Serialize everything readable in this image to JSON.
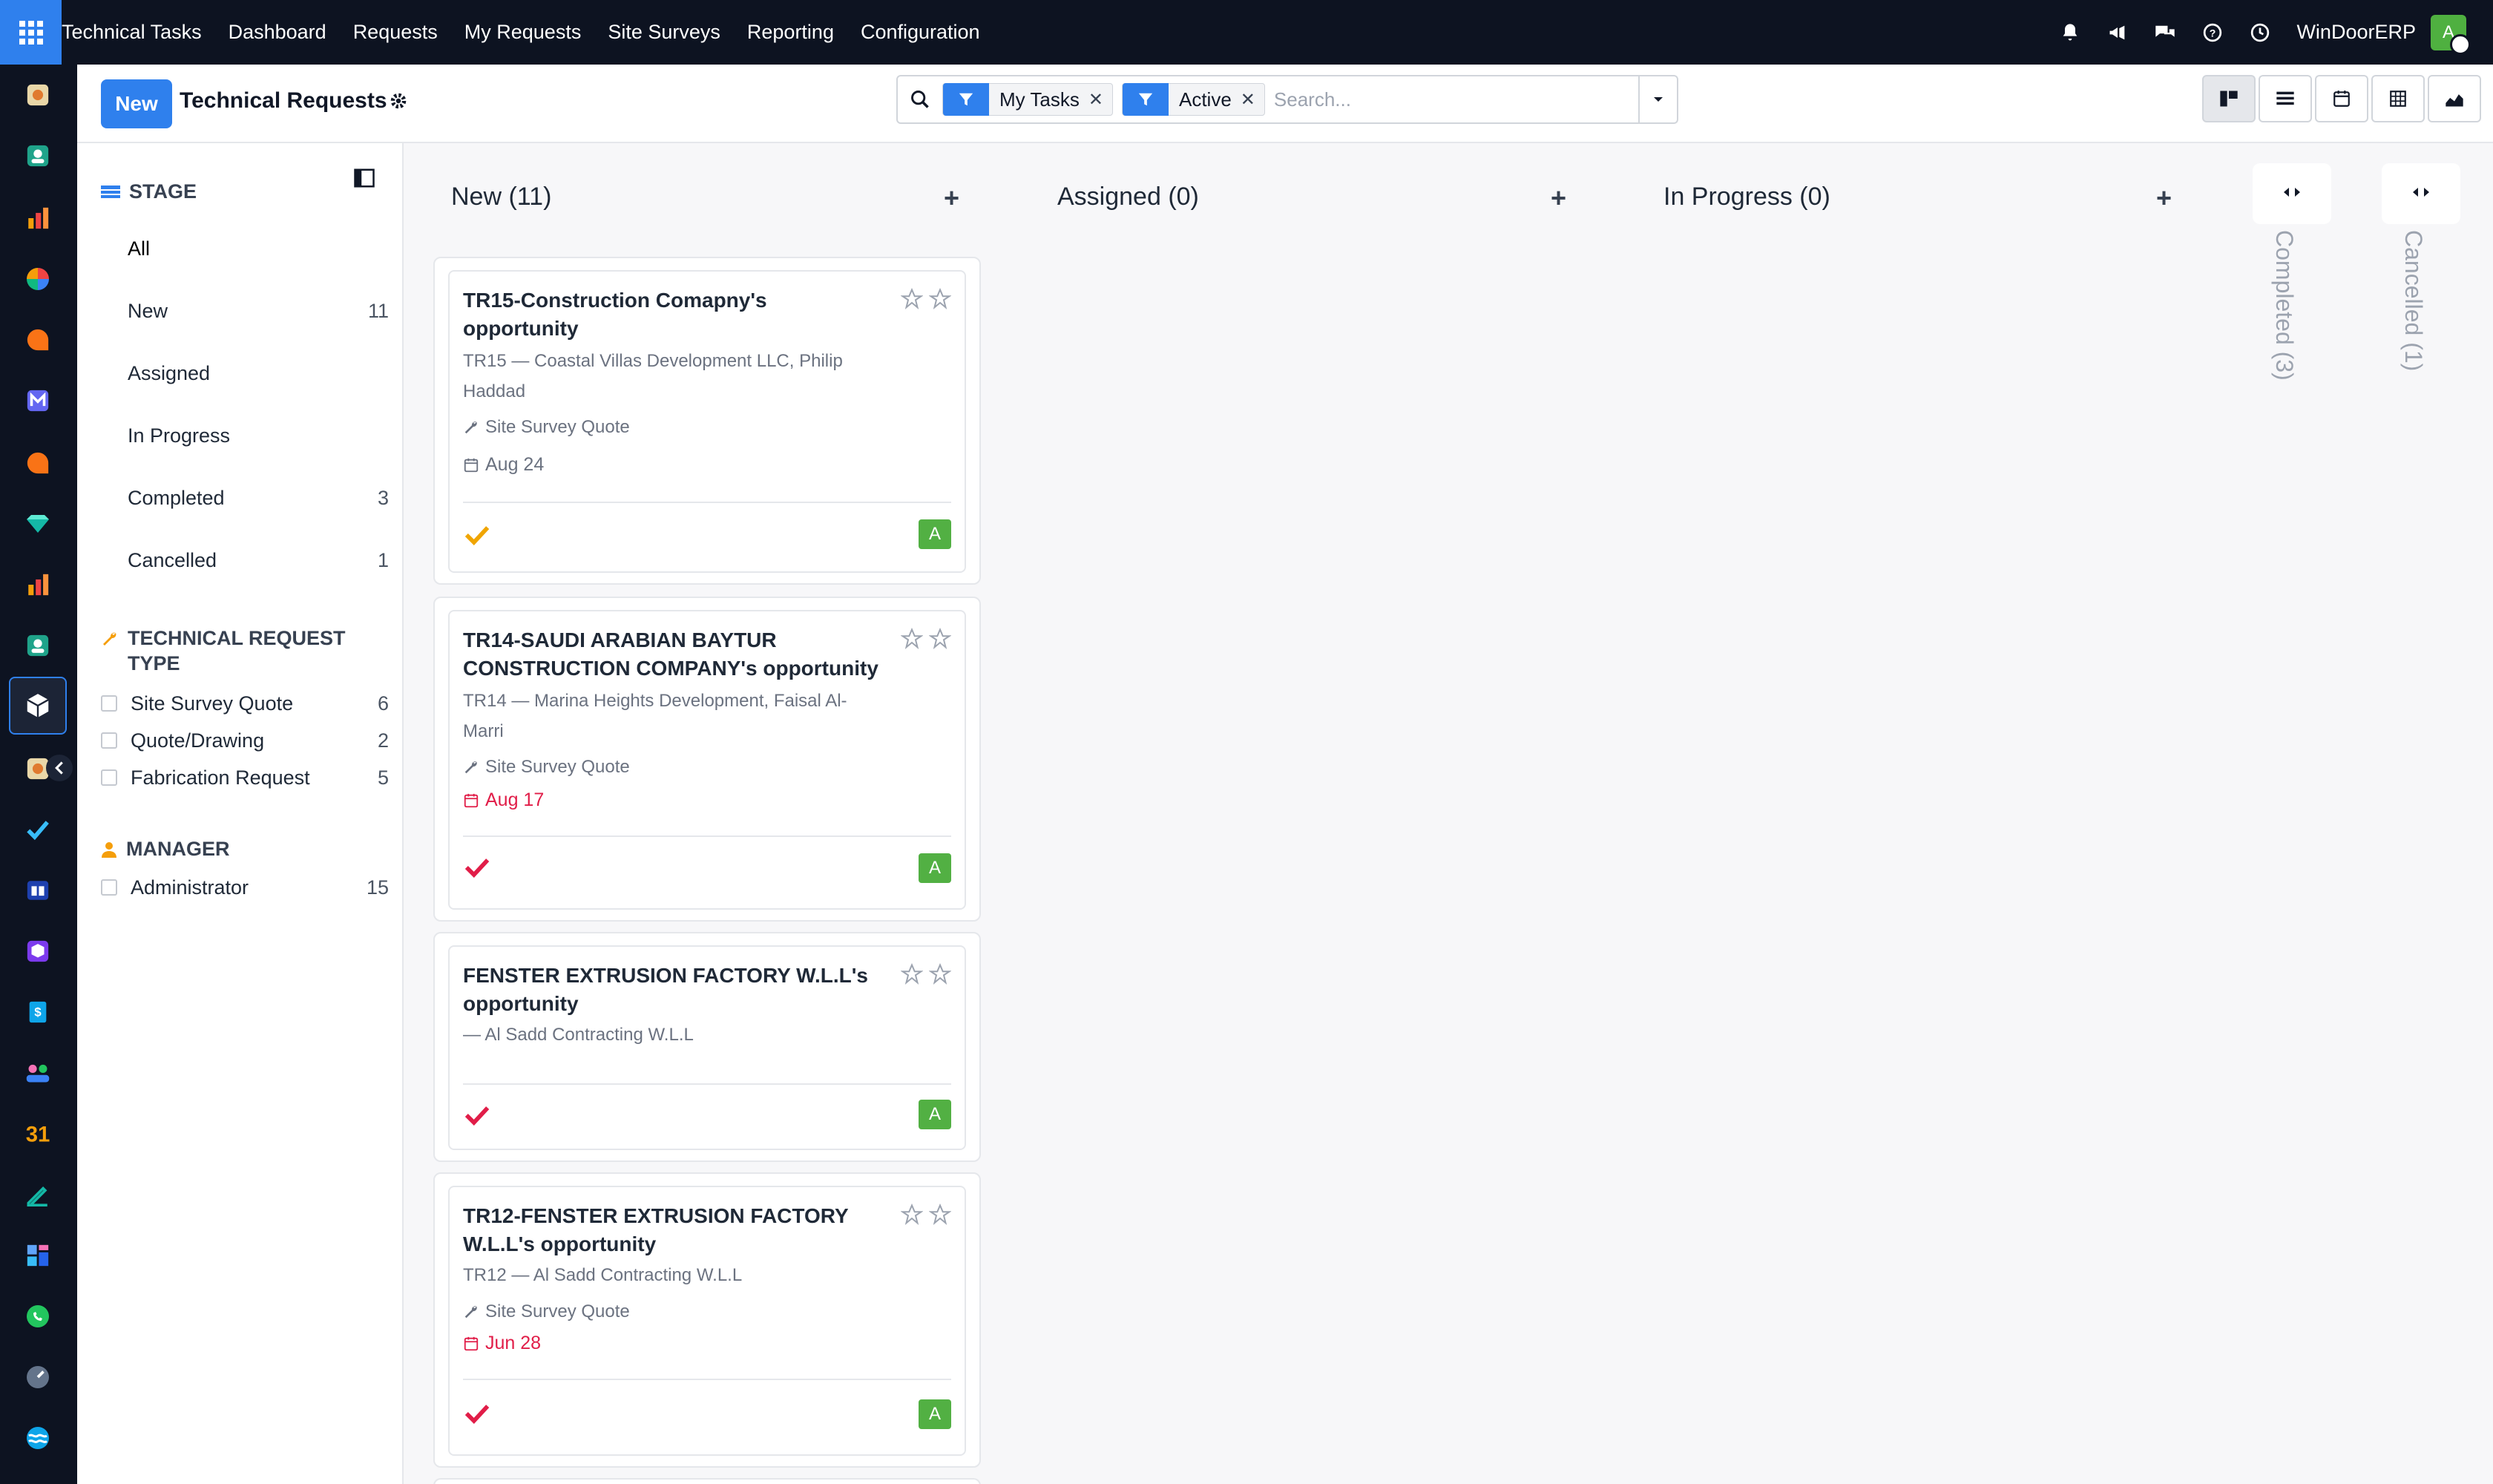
{
  "nav": {
    "app_name": "Technical Tasks",
    "menu": [
      "Dashboard",
      "Requests",
      "My Requests",
      "Site Surveys",
      "Reporting",
      "Configuration"
    ],
    "company": "WinDoorERP",
    "user_initial": "A"
  },
  "control": {
    "new_label": "New",
    "title": "Technical Requests",
    "facets": [
      "My Tasks",
      "Active"
    ],
    "search_placeholder": "Search..."
  },
  "sidebar": {
    "stage_header": "STAGE",
    "stages": [
      {
        "label": "All",
        "count": ""
      },
      {
        "label": "New",
        "count": "11"
      },
      {
        "label": "Assigned",
        "count": ""
      },
      {
        "label": "In Progress",
        "count": ""
      },
      {
        "label": "Completed",
        "count": "3"
      },
      {
        "label": "Cancelled",
        "count": "1"
      }
    ],
    "type_header": "TECHNICAL REQUEST TYPE",
    "types": [
      {
        "label": "Site Survey Quote",
        "count": "6"
      },
      {
        "label": "Quote/Drawing",
        "count": "2"
      },
      {
        "label": "Fabrication Request",
        "count": "5"
      }
    ],
    "manager_header": "MANAGER",
    "managers": [
      {
        "label": "Administrator",
        "count": "15"
      }
    ]
  },
  "columns": [
    {
      "title": "New (11)"
    },
    {
      "title": "Assigned (0)"
    },
    {
      "title": "In Progress (0)"
    }
  ],
  "folded_columns": [
    {
      "title": "Completed (3)"
    },
    {
      "title": "Cancelled (1)"
    }
  ],
  "cards": [
    {
      "title": "TR15-Construction Comapny's opportunity",
      "subtitle": "TR15 — Coastal Villas Development LLC, Philip Haddad",
      "type": "Site Survey Quote",
      "date": "Aug 24",
      "overdue": false,
      "check_color": "#f0a500",
      "assignee": "A"
    },
    {
      "title": "TR14-SAUDI ARABIAN BAYTUR CONSTRUCTION COMPANY's opportunity",
      "subtitle": "TR14 — Marina Heights Development, Faisal Al-Marri",
      "type": "Site Survey Quote",
      "date": "Aug 17",
      "overdue": true,
      "check_color": "#e11d48",
      "assignee": "A"
    },
    {
      "title": "FENSTER EXTRUSION FACTORY W.L.L's opportunity",
      "subtitle": "— Al Sadd Contracting W.L.L",
      "type": "",
      "date": "",
      "overdue": false,
      "check_color": "#e11d48",
      "assignee": "A"
    },
    {
      "title": "TR12-FENSTER EXTRUSION FACTORY W.L.L's opportunity",
      "subtitle": "TR12 — Al Sadd Contracting W.L.L",
      "type": "Site Survey Quote",
      "date": "Jun 28",
      "overdue": true,
      "check_color": "#e11d48",
      "assignee": "A"
    }
  ],
  "colors": {
    "primary": "#2f80ed",
    "navbar": "#0d1321",
    "overdue": "#e11d48",
    "avatar": "#52b043"
  }
}
